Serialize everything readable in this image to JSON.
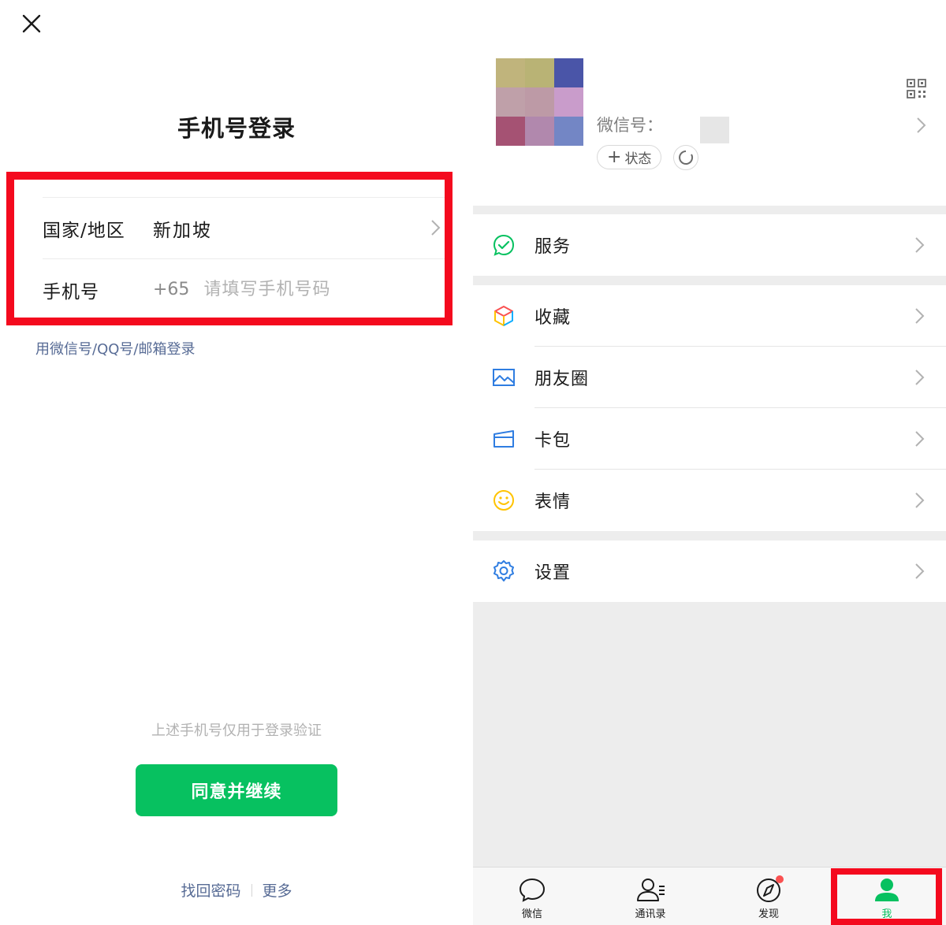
{
  "left": {
    "title": "手机号登录",
    "form": {
      "region_label": "国家/地区",
      "region_value": "新加坡",
      "phone_label": "手机号",
      "phone_prefix": "+65",
      "phone_placeholder": "请填写手机号码",
      "phone_value": ""
    },
    "alt_login": "用微信号/QQ号/邮箱登录",
    "notice": "上述手机号仅用于登录验证",
    "agree_button": "同意并继续",
    "links": {
      "recover": "找回密码",
      "more": "更多"
    }
  },
  "right": {
    "profile": {
      "wechat_id_label": "微信号：",
      "status_label": "状态",
      "avatar_colors": [
        "#c0b47c",
        "#b9b375",
        "#4a55a8",
        "#bfa0a9",
        "#bd9aa6",
        "#c99ccb",
        "#a55273",
        "#b188ad",
        "#7386c5"
      ]
    },
    "menu": [
      {
        "label": "服务",
        "icon": "service-icon"
      },
      {
        "label": "收藏",
        "icon": "favorites-icon"
      },
      {
        "label": "朋友圈",
        "icon": "moments-icon"
      },
      {
        "label": "卡包",
        "icon": "card-wallet-icon"
      },
      {
        "label": "表情",
        "icon": "sticker-icon"
      },
      {
        "label": "设置",
        "icon": "settings-icon"
      }
    ],
    "tabs": [
      {
        "label": "微信",
        "icon": "chat-bubble-icon"
      },
      {
        "label": "通讯录",
        "icon": "contacts-icon"
      },
      {
        "label": "发现",
        "icon": "compass-icon"
      },
      {
        "label": "我",
        "icon": "person-icon"
      }
    ]
  },
  "colors": {
    "brand_green": "#07c160",
    "link_blue": "#576b95",
    "highlight_red": "#f40a1e",
    "badge_red": "#fa5151"
  }
}
